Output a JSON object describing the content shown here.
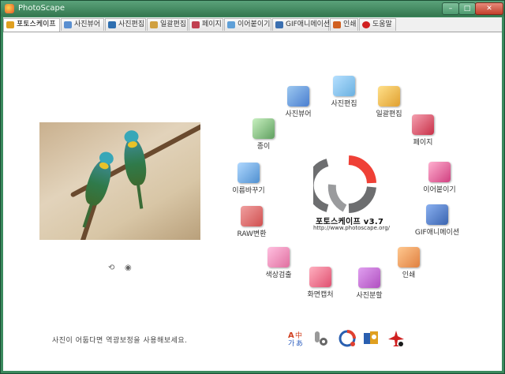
{
  "window": {
    "title": "PhotoScape"
  },
  "tabs": [
    {
      "label": "포토스케이프",
      "color": "#e0a020"
    },
    {
      "label": "사진뷰어",
      "color": "#5a8fd0"
    },
    {
      "label": "사진편집",
      "color": "#2f6fb0"
    },
    {
      "label": "일괄편집",
      "color": "#d0a040"
    },
    {
      "label": "페이지",
      "color": "#c04050"
    },
    {
      "label": "이어붙이기",
      "color": "#5fa0d8"
    },
    {
      "label": "GIF애니메이션",
      "color": "#3b6fb0"
    },
    {
      "label": "인쇄",
      "color": "#d06020"
    },
    {
      "label": "도움말",
      "color": "#d02020"
    }
  ],
  "main": {
    "hint": "사진이 어둡다면 역광보정을 사용해보세요.",
    "logo_name": "포토스케이프 v3.7",
    "logo_url": "http://www.photoscape.org/"
  },
  "menu": [
    {
      "label": "사진뷰어",
      "color": "#4a7ed0"
    },
    {
      "label": "사진편집",
      "color": "#6ab0e0"
    },
    {
      "label": "일괄편집",
      "color": "#e0a030"
    },
    {
      "label": "페이지",
      "color": "#c83048"
    },
    {
      "label": "이어붙이기",
      "color": "#d04080"
    },
    {
      "label": "GIF애니메이션",
      "color": "#3a64b0"
    },
    {
      "label": "인쇄",
      "color": "#e08040"
    },
    {
      "label": "사진분할",
      "color": "#b050c0"
    },
    {
      "label": "화면캡처",
      "color": "#e05070"
    },
    {
      "label": "색상검출",
      "color": "#e070a0"
    },
    {
      "label": "RAW변환",
      "color": "#d05050"
    },
    {
      "label": "이름바꾸기",
      "color": "#5090d0"
    },
    {
      "label": "종이",
      "color": "#60a060"
    }
  ],
  "bottom_icons": [
    {
      "name": "language-icon",
      "color": "#d04020"
    },
    {
      "name": "tools-icon",
      "color": "#888888"
    },
    {
      "name": "photoscape-logo-icon",
      "color": "#e04030"
    },
    {
      "name": "template-icon",
      "color": "#e0a020"
    },
    {
      "name": "plane-icon",
      "color": "#d02020"
    }
  ],
  "colors": {
    "logo_red": "#ef4036",
    "logo_gray": "#6d6e70"
  }
}
